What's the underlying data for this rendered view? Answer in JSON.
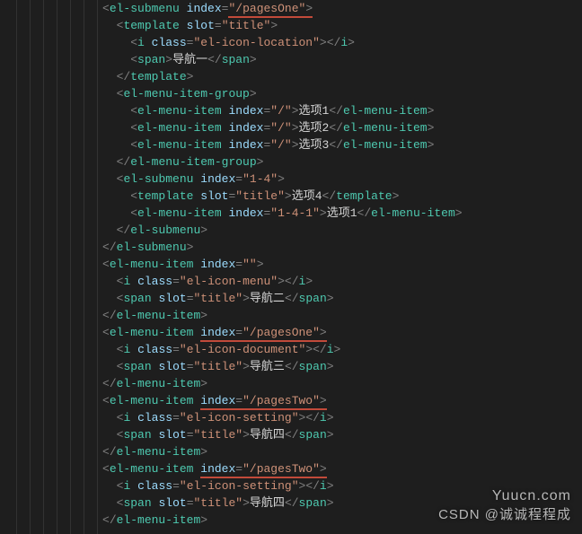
{
  "indents": [
    5,
    6,
    7,
    7,
    6,
    6,
    7,
    7,
    7,
    6,
    6,
    7,
    7,
    6,
    5,
    5,
    6,
    6,
    5,
    5,
    6,
    6,
    5,
    5,
    6,
    6,
    5,
    5,
    6,
    6,
    5
  ],
  "lines": [
    [
      {
        "t": "<",
        "c": "pun"
      },
      {
        "t": "el-submenu",
        "c": "tag"
      },
      {
        "t": " ",
        "c": ""
      },
      {
        "t": "index",
        "c": "attr"
      },
      {
        "t": "=",
        "c": "pun"
      },
      {
        "u": true,
        "seg": [
          {
            "t": "\"/pagesOne\"",
            "c": "str"
          },
          {
            "t": ">",
            "c": "pun"
          }
        ]
      }
    ],
    [
      {
        "t": "<",
        "c": "pun"
      },
      {
        "t": "template",
        "c": "tag"
      },
      {
        "t": " ",
        "c": ""
      },
      {
        "t": "slot",
        "c": "attr"
      },
      {
        "t": "=",
        "c": "pun"
      },
      {
        "t": "\"title\"",
        "c": "str"
      },
      {
        "t": ">",
        "c": "pun"
      }
    ],
    [
      {
        "t": "<",
        "c": "pun"
      },
      {
        "t": "i",
        "c": "tag"
      },
      {
        "t": " ",
        "c": ""
      },
      {
        "t": "class",
        "c": "attr"
      },
      {
        "t": "=",
        "c": "pun"
      },
      {
        "t": "\"el-icon-location\"",
        "c": "str"
      },
      {
        "t": "></",
        "c": "pun"
      },
      {
        "t": "i",
        "c": "tag"
      },
      {
        "t": ">",
        "c": "pun"
      }
    ],
    [
      {
        "t": "<",
        "c": "pun"
      },
      {
        "t": "span",
        "c": "tag"
      },
      {
        "t": ">",
        "c": "pun"
      },
      {
        "t": "导航一",
        "c": "txt"
      },
      {
        "t": "</",
        "c": "pun"
      },
      {
        "t": "span",
        "c": "tag"
      },
      {
        "t": ">",
        "c": "pun"
      }
    ],
    [
      {
        "t": "</",
        "c": "pun"
      },
      {
        "t": "template",
        "c": "tag"
      },
      {
        "t": ">",
        "c": "pun"
      }
    ],
    [
      {
        "t": "<",
        "c": "pun"
      },
      {
        "t": "el-menu-item-group",
        "c": "tag"
      },
      {
        "t": ">",
        "c": "pun"
      }
    ],
    [
      {
        "t": "<",
        "c": "pun"
      },
      {
        "t": "el-menu-item",
        "c": "tag"
      },
      {
        "t": " ",
        "c": ""
      },
      {
        "t": "index",
        "c": "attr"
      },
      {
        "t": "=",
        "c": "pun"
      },
      {
        "t": "\"/\"",
        "c": "str"
      },
      {
        "t": ">",
        "c": "pun"
      },
      {
        "t": "选项1",
        "c": "txt"
      },
      {
        "t": "</",
        "c": "pun"
      },
      {
        "t": "el-menu-item",
        "c": "tag"
      },
      {
        "t": ">",
        "c": "pun"
      }
    ],
    [
      {
        "t": "<",
        "c": "pun"
      },
      {
        "t": "el-menu-item",
        "c": "tag"
      },
      {
        "t": " ",
        "c": ""
      },
      {
        "t": "index",
        "c": "attr"
      },
      {
        "t": "=",
        "c": "pun"
      },
      {
        "t": "\"/\"",
        "c": "str"
      },
      {
        "t": ">",
        "c": "pun"
      },
      {
        "t": "选项2",
        "c": "txt"
      },
      {
        "t": "</",
        "c": "pun"
      },
      {
        "t": "el-menu-item",
        "c": "tag"
      },
      {
        "t": ">",
        "c": "pun"
      }
    ],
    [
      {
        "t": "<",
        "c": "pun"
      },
      {
        "t": "el-menu-item",
        "c": "tag"
      },
      {
        "t": " ",
        "c": ""
      },
      {
        "t": "index",
        "c": "attr"
      },
      {
        "t": "=",
        "c": "pun"
      },
      {
        "t": "\"/\"",
        "c": "str"
      },
      {
        "t": ">",
        "c": "pun"
      },
      {
        "t": "选项3",
        "c": "txt"
      },
      {
        "t": "</",
        "c": "pun"
      },
      {
        "t": "el-menu-item",
        "c": "tag"
      },
      {
        "t": ">",
        "c": "pun"
      }
    ],
    [
      {
        "t": "</",
        "c": "pun"
      },
      {
        "t": "el-menu-item-group",
        "c": "tag"
      },
      {
        "t": ">",
        "c": "pun"
      }
    ],
    [
      {
        "t": "<",
        "c": "pun"
      },
      {
        "t": "el-submenu",
        "c": "tag"
      },
      {
        "t": " ",
        "c": ""
      },
      {
        "t": "index",
        "c": "attr"
      },
      {
        "t": "=",
        "c": "pun"
      },
      {
        "t": "\"1-4\"",
        "c": "str"
      },
      {
        "t": ">",
        "c": "pun"
      }
    ],
    [
      {
        "t": "<",
        "c": "pun"
      },
      {
        "t": "template",
        "c": "tag"
      },
      {
        "t": " ",
        "c": ""
      },
      {
        "t": "slot",
        "c": "attr"
      },
      {
        "t": "=",
        "c": "pun"
      },
      {
        "t": "\"title\"",
        "c": "str"
      },
      {
        "t": ">",
        "c": "pun"
      },
      {
        "t": "选项4",
        "c": "txt"
      },
      {
        "t": "</",
        "c": "pun"
      },
      {
        "t": "template",
        "c": "tag"
      },
      {
        "t": ">",
        "c": "pun"
      }
    ],
    [
      {
        "t": "<",
        "c": "pun"
      },
      {
        "t": "el-menu-item",
        "c": "tag"
      },
      {
        "t": " ",
        "c": ""
      },
      {
        "t": "index",
        "c": "attr"
      },
      {
        "t": "=",
        "c": "pun"
      },
      {
        "t": "\"1-4-1\"",
        "c": "str"
      },
      {
        "t": ">",
        "c": "pun"
      },
      {
        "t": "选项1",
        "c": "txt"
      },
      {
        "t": "</",
        "c": "pun"
      },
      {
        "t": "el-menu-item",
        "c": "tag"
      },
      {
        "t": ">",
        "c": "pun"
      }
    ],
    [
      {
        "t": "</",
        "c": "pun"
      },
      {
        "t": "el-submenu",
        "c": "tag"
      },
      {
        "t": ">",
        "c": "pun"
      }
    ],
    [
      {
        "t": "</",
        "c": "pun"
      },
      {
        "t": "el-submenu",
        "c": "tag"
      },
      {
        "t": ">",
        "c": "pun"
      }
    ],
    [
      {
        "t": "<",
        "c": "pun"
      },
      {
        "t": "el-menu-item",
        "c": "tag"
      },
      {
        "t": " ",
        "c": ""
      },
      {
        "t": "index",
        "c": "attr"
      },
      {
        "t": "=",
        "c": "pun"
      },
      {
        "t": "\"\"",
        "c": "str"
      },
      {
        "t": ">",
        "c": "pun"
      }
    ],
    [
      {
        "t": "<",
        "c": "pun"
      },
      {
        "t": "i",
        "c": "tag"
      },
      {
        "t": " ",
        "c": ""
      },
      {
        "t": "class",
        "c": "attr"
      },
      {
        "t": "=",
        "c": "pun"
      },
      {
        "t": "\"el-icon-menu\"",
        "c": "str"
      },
      {
        "t": "></",
        "c": "pun"
      },
      {
        "t": "i",
        "c": "tag"
      },
      {
        "t": ">",
        "c": "pun"
      }
    ],
    [
      {
        "t": "<",
        "c": "pun"
      },
      {
        "t": "span",
        "c": "tag"
      },
      {
        "t": " ",
        "c": ""
      },
      {
        "t": "slot",
        "c": "attr"
      },
      {
        "t": "=",
        "c": "pun"
      },
      {
        "t": "\"title\"",
        "c": "str"
      },
      {
        "t": ">",
        "c": "pun"
      },
      {
        "t": "导航二",
        "c": "txt"
      },
      {
        "t": "</",
        "c": "pun"
      },
      {
        "t": "span",
        "c": "tag"
      },
      {
        "t": ">",
        "c": "pun"
      }
    ],
    [
      {
        "t": "</",
        "c": "pun"
      },
      {
        "t": "el-menu-item",
        "c": "tag"
      },
      {
        "t": ">",
        "c": "pun"
      }
    ],
    [
      {
        "t": "<",
        "c": "pun"
      },
      {
        "t": "el-menu-item",
        "c": "tag"
      },
      {
        "t": " ",
        "c": ""
      },
      {
        "u": true,
        "seg": [
          {
            "t": "index",
            "c": "attr"
          },
          {
            "t": "=",
            "c": "pun"
          },
          {
            "t": "\"/pagesOne\"",
            "c": "str"
          },
          {
            "t": ">",
            "c": "pun"
          }
        ]
      }
    ],
    [
      {
        "t": "<",
        "c": "pun"
      },
      {
        "t": "i",
        "c": "tag"
      },
      {
        "t": " ",
        "c": ""
      },
      {
        "t": "class",
        "c": "attr"
      },
      {
        "t": "=",
        "c": "pun"
      },
      {
        "t": "\"el-icon-document\"",
        "c": "str"
      },
      {
        "t": "></",
        "c": "pun"
      },
      {
        "t": "i",
        "c": "tag"
      },
      {
        "t": ">",
        "c": "pun"
      }
    ],
    [
      {
        "t": "<",
        "c": "pun"
      },
      {
        "t": "span",
        "c": "tag"
      },
      {
        "t": " ",
        "c": ""
      },
      {
        "t": "slot",
        "c": "attr"
      },
      {
        "t": "=",
        "c": "pun"
      },
      {
        "t": "\"title\"",
        "c": "str"
      },
      {
        "t": ">",
        "c": "pun"
      },
      {
        "t": "导航三",
        "c": "txt"
      },
      {
        "t": "</",
        "c": "pun"
      },
      {
        "t": "span",
        "c": "tag"
      },
      {
        "t": ">",
        "c": "pun"
      }
    ],
    [
      {
        "t": "</",
        "c": "pun"
      },
      {
        "t": "el-menu-item",
        "c": "tag"
      },
      {
        "t": ">",
        "c": "pun"
      }
    ],
    [
      {
        "t": "<",
        "c": "pun"
      },
      {
        "t": "el-menu-item",
        "c": "tag"
      },
      {
        "t": " ",
        "c": ""
      },
      {
        "u": true,
        "seg": [
          {
            "t": "index",
            "c": "attr"
          },
          {
            "t": "=",
            "c": "pun"
          },
          {
            "t": "\"/pagesTwo\"",
            "c": "str"
          },
          {
            "t": ">",
            "c": "pun"
          }
        ]
      }
    ],
    [
      {
        "t": "<",
        "c": "pun"
      },
      {
        "t": "i",
        "c": "tag"
      },
      {
        "t": " ",
        "c": ""
      },
      {
        "t": "class",
        "c": "attr"
      },
      {
        "t": "=",
        "c": "pun"
      },
      {
        "t": "\"el-icon-setting\"",
        "c": "str"
      },
      {
        "t": "></",
        "c": "pun"
      },
      {
        "t": "i",
        "c": "tag"
      },
      {
        "t": ">",
        "c": "pun"
      }
    ],
    [
      {
        "t": "<",
        "c": "pun"
      },
      {
        "t": "span",
        "c": "tag"
      },
      {
        "t": " ",
        "c": ""
      },
      {
        "t": "slot",
        "c": "attr"
      },
      {
        "t": "=",
        "c": "pun"
      },
      {
        "t": "\"title\"",
        "c": "str"
      },
      {
        "t": ">",
        "c": "pun"
      },
      {
        "t": "导航四",
        "c": "txt"
      },
      {
        "t": "</",
        "c": "pun"
      },
      {
        "t": "span",
        "c": "tag"
      },
      {
        "t": ">",
        "c": "pun"
      }
    ],
    [
      {
        "t": "</",
        "c": "pun"
      },
      {
        "t": "el-menu-item",
        "c": "tag"
      },
      {
        "t": ">",
        "c": "pun"
      }
    ],
    [
      {
        "t": "<",
        "c": "pun"
      },
      {
        "t": "el-menu-item",
        "c": "tag"
      },
      {
        "t": " ",
        "c": ""
      },
      {
        "u": true,
        "seg": [
          {
            "t": "index",
            "c": "attr"
          },
          {
            "t": "=",
            "c": "pun"
          },
          {
            "t": "\"/pagesTwo\"",
            "c": "str"
          },
          {
            "t": ">",
            "c": "pun"
          }
        ]
      }
    ],
    [
      {
        "t": "<",
        "c": "pun"
      },
      {
        "t": "i",
        "c": "tag"
      },
      {
        "t": " ",
        "c": ""
      },
      {
        "t": "class",
        "c": "attr"
      },
      {
        "t": "=",
        "c": "pun"
      },
      {
        "t": "\"el-icon-setting\"",
        "c": "str"
      },
      {
        "t": "></",
        "c": "pun"
      },
      {
        "t": "i",
        "c": "tag"
      },
      {
        "t": ">",
        "c": "pun"
      }
    ],
    [
      {
        "t": "<",
        "c": "pun"
      },
      {
        "t": "span",
        "c": "tag"
      },
      {
        "t": " ",
        "c": ""
      },
      {
        "t": "slot",
        "c": "attr"
      },
      {
        "t": "=",
        "c": "pun"
      },
      {
        "t": "\"title\"",
        "c": "str"
      },
      {
        "t": ">",
        "c": "pun"
      },
      {
        "t": "导航四",
        "c": "txt"
      },
      {
        "t": "</",
        "c": "pun"
      },
      {
        "t": "span",
        "c": "tag"
      },
      {
        "t": ">",
        "c": "pun"
      }
    ],
    [
      {
        "t": "</",
        "c": "pun"
      },
      {
        "t": "el-menu-item",
        "c": "tag"
      },
      {
        "t": ">",
        "c": "pun"
      }
    ]
  ],
  "watermark": {
    "site": "Yuucn.com",
    "author": "CSDN @诚诚程程成"
  }
}
